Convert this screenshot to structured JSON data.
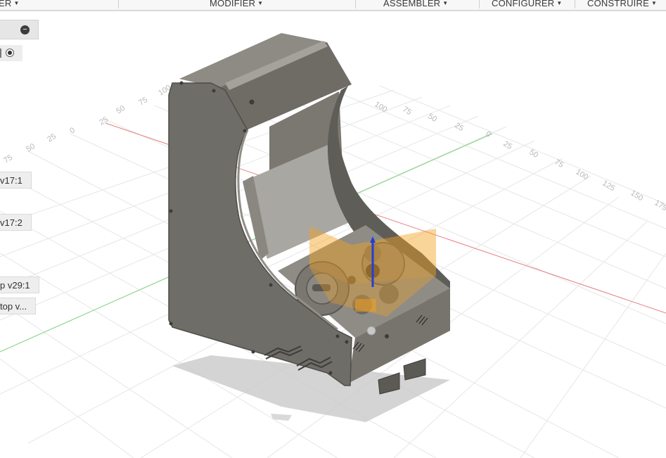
{
  "toolbar": {
    "menus": [
      {
        "label": "ER"
      },
      {
        "label": "MODIFIER"
      },
      {
        "label": "ASSEMBLER"
      },
      {
        "label": "CONFIGURER"
      },
      {
        "label": "CONSTRUIRE"
      }
    ]
  },
  "browser": {
    "components": [
      {
        "label": "v17:1"
      },
      {
        "label": "v17:2"
      },
      {
        "label": "p v29:1"
      },
      {
        "label": "top v..."
      }
    ]
  },
  "grid": {
    "back_ticks": [
      "75",
      "50",
      "25",
      "0",
      "25",
      "50",
      "75",
      "100",
      "125"
    ],
    "right_ticks": [
      "100",
      "75",
      "50",
      "25",
      "0",
      "25",
      "50",
      "75",
      "100",
      "125",
      "150",
      "175"
    ]
  },
  "colors": {
    "body_gray": "#6f6d68",
    "selection_orange": "#f4a11f",
    "x_axis_red": "#e06060",
    "y_axis_green": "#5ac85a"
  }
}
